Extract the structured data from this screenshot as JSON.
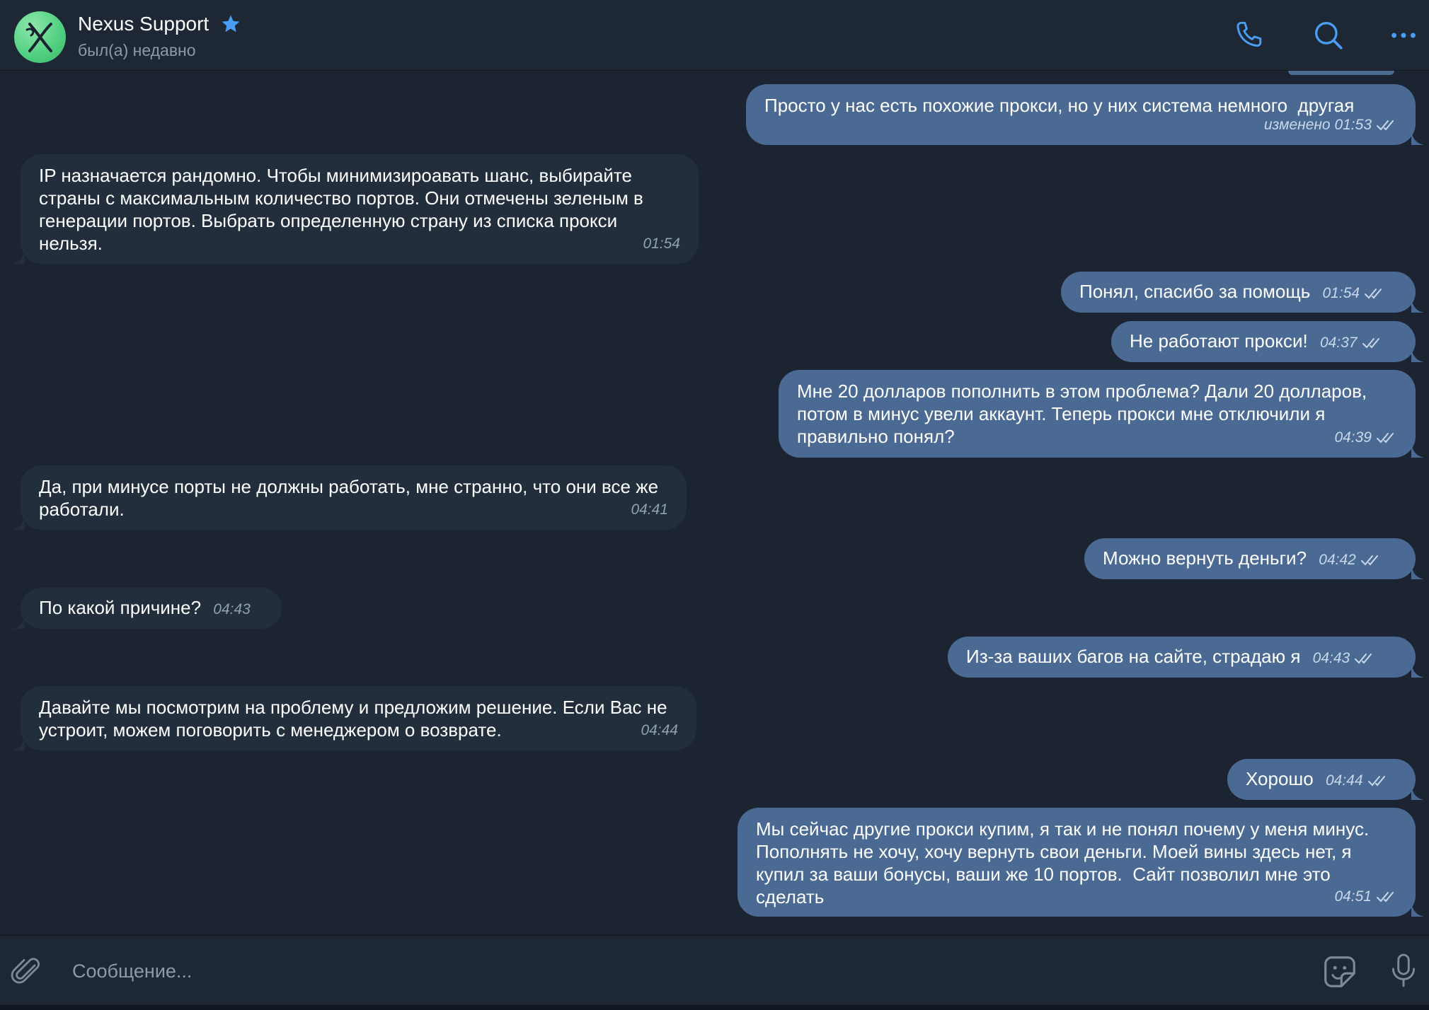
{
  "header": {
    "contact_name": "Nexus Support",
    "status": "был(а) недавно",
    "icons": [
      "avatar-logo-icon",
      "verified-star-icon",
      "phone-icon",
      "search-icon",
      "more-icon"
    ],
    "accent_color": "#4a9df5"
  },
  "messages": [
    {
      "dir": "out",
      "text": "Просто у нас есть похожие прокси, но у них система немного  другая",
      "time": "изменено 01:53",
      "read": true
    },
    {
      "dir": "in",
      "text": "IP назначается рандомно. Чтобы минимизироавать шанс, выбирайте страны с максимальным количество портов. Они отмечены зеленым в генерации портов. Выбрать определенную страну из списка прокси нельзя.",
      "time": "01:54"
    },
    {
      "dir": "out",
      "text": "Понял, спасибо за помощь",
      "time": "01:54",
      "read": true
    },
    {
      "dir": "out",
      "text": "Не работают прокси!",
      "time": "04:37",
      "read": true
    },
    {
      "dir": "out",
      "text": "Мне 20 долларов пополнить в этом проблема? Дали 20 долларов, потом в минус увели аккаунт. Теперь прокси мне отключили я правильно понял?",
      "time": "04:39",
      "read": true
    },
    {
      "dir": "in",
      "text": "Да, при минусе порты не должны работать, мне странно, что они все же работали.",
      "time": "04:41"
    },
    {
      "dir": "out",
      "text": "Можно вернуть деньги?",
      "time": "04:42",
      "read": true
    },
    {
      "dir": "in",
      "text": "По какой причине?",
      "time": "04:43"
    },
    {
      "dir": "out",
      "text": "Из-за ваших багов на сайте, страдаю я",
      "time": "04:43",
      "read": true
    },
    {
      "dir": "in",
      "text": "Давайте мы посмотрим на проблему и предложим решение. Если Вас не устроит, можем поговорить с менеджером о возврате.",
      "time": "04:44"
    },
    {
      "dir": "out",
      "text": "Хорошо",
      "time": "04:44",
      "read": true
    },
    {
      "dir": "out",
      "text": "Мы сейчас другие прокси купим, я так и не понял почему у меня минус. Пополнять не хочу, хочу вернуть свои деньги. Моей вины здесь нет, я купил за ваши бонусы, ваши же 10 портов.  Сайт позволил мне это сделать",
      "time": "04:51",
      "read": true
    }
  ],
  "composer": {
    "placeholder": "Сообщение...",
    "icons": [
      "attach-icon",
      "sticker-icon",
      "microphone-icon"
    ]
  },
  "colors": {
    "background": "#1b2430",
    "incoming_bubble": "#232e3c",
    "outgoing_bubble": "#4a6a94"
  }
}
